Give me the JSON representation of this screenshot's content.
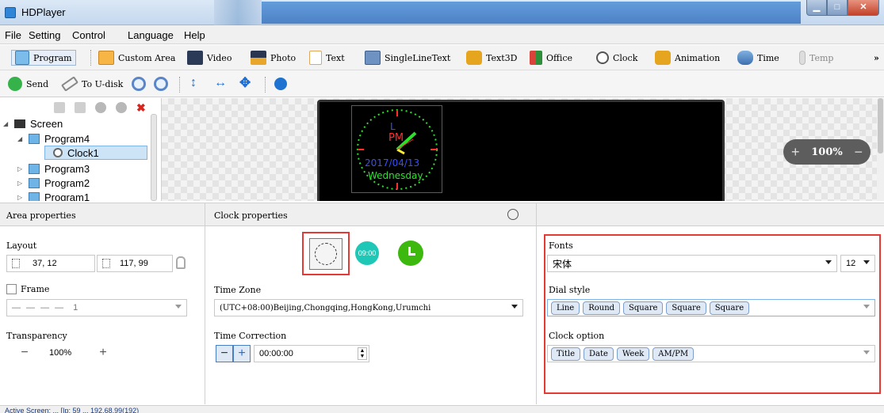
{
  "window": {
    "title": "HDPlayer"
  },
  "menu": [
    "File",
    "Setting",
    "Control",
    "Language",
    "Help"
  ],
  "toolbar1": {
    "program": "Program",
    "custom_area": "Custom Area",
    "video": "Video",
    "photo": "Photo",
    "text": "Text",
    "single_line_text": "SingleLineText",
    "text3d": "Text3D",
    "office": "Office",
    "clock": "Clock",
    "animation": "Animation",
    "time": "Time",
    "temp": "Temp",
    "more": "»"
  },
  "toolbar2": {
    "send": "Send",
    "to_udisk": "To U-disk"
  },
  "tree": {
    "screen": "Screen",
    "program4": "Program4",
    "clock1": "Clock1",
    "program3": "Program3",
    "program2": "Program2",
    "program1": "Program1"
  },
  "preview": {
    "date": "2017/04/13",
    "weekday": "Wednesday",
    "ampm": "PM",
    "title_char": "L"
  },
  "zoom": {
    "value": "100%",
    "plus": "+",
    "minus": "−"
  },
  "area_properties": {
    "header": "Area properties",
    "layout_label": "Layout",
    "position": "37, 12",
    "size": "117, 99",
    "frame_label": "Frame",
    "frame_value": "1",
    "transparency_label": "Transparency",
    "transparency_value": "100%"
  },
  "clock_properties": {
    "header": "Clock properties",
    "digital_clock_text": "09:00",
    "time_zone_label": "Time Zone",
    "time_zone_value": "(UTC+08:00)Beijing,Chongqing,HongKong,Urumchi",
    "time_correction_label": "Time Correction",
    "time_correction_value": "00:00:00"
  },
  "style_properties": {
    "fonts_label": "Fonts",
    "font_value": "宋体",
    "font_size": "12",
    "dial_style_label": "Dial style",
    "dial_styles": [
      "Line",
      "Round",
      "Square",
      "Square",
      "Square"
    ],
    "clock_option_label": "Clock option",
    "clock_options": [
      "Title",
      "Date",
      "Week",
      "AM/PM"
    ]
  },
  "status": {
    "text": "Active Screen: ... [Ip: 59 ... 192.68.99(192)"
  },
  "colors": {
    "highlight": "#e53935",
    "accent_teal": "#1fc8b6",
    "accent_green": "#3cb80f"
  }
}
